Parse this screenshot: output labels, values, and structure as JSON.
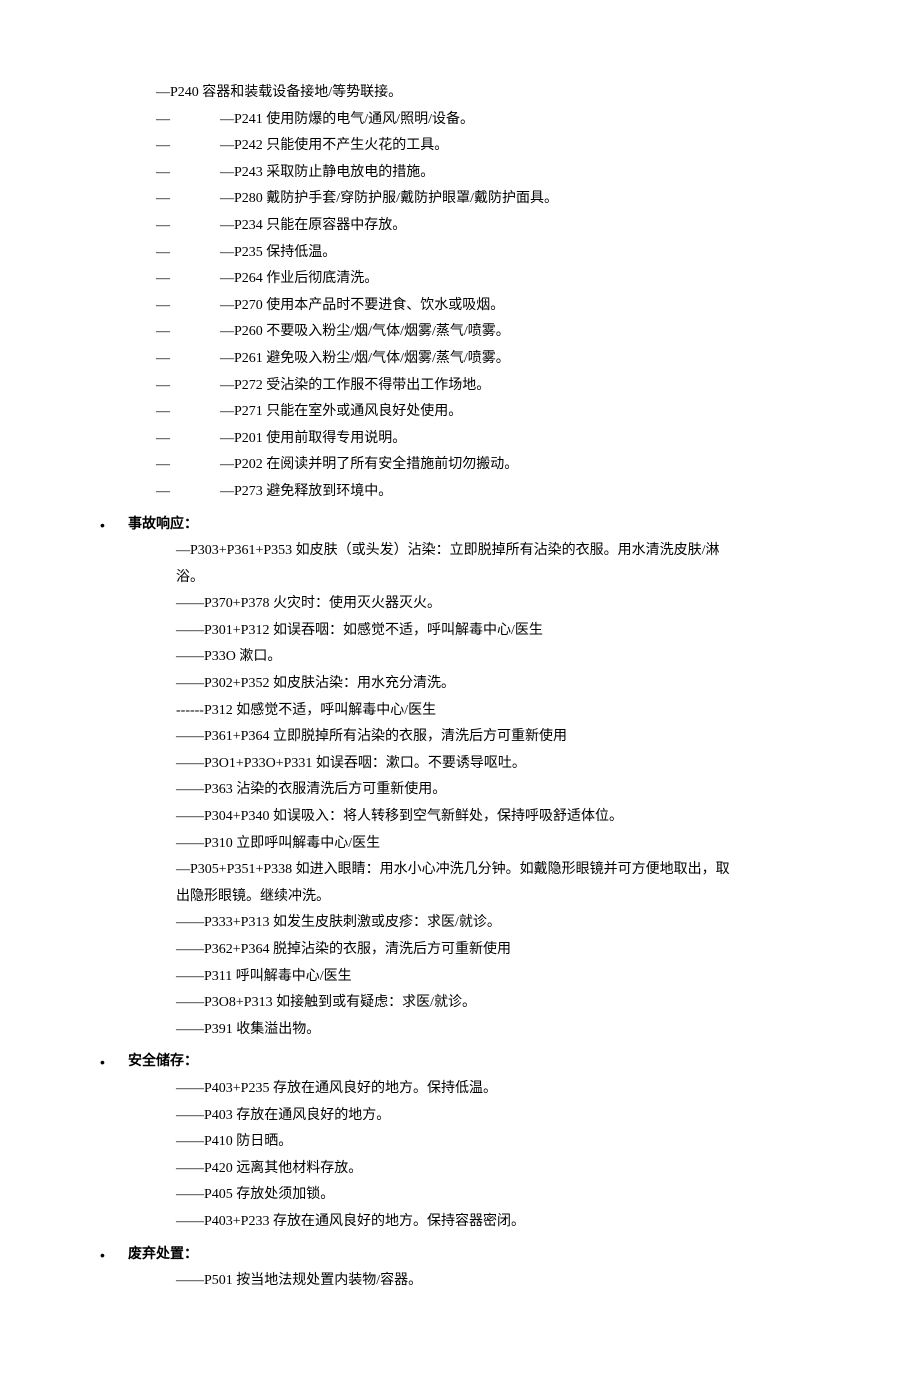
{
  "precaution_first": "—P240 容器和装载设备接地/等势联接。",
  "precaution_lines": [
    "—P241 使用防爆的电气/通风/照明/设备。",
    "—P242 只能使用不产生火花的工具。",
    "—P243 采取防止静电放电的措施。",
    "—P280 戴防护手套/穿防护服/戴防护眼罩/戴防护面具。",
    "—P234 只能在原容器中存放。",
    "—P235 保持低温。",
    "—P264 作业后彻底清洗。",
    "—P270 使用本产品时不要进食、饮水或吸烟。",
    "—P260 不要吸入粉尘/烟/气体/烟雾/蒸气/喷雾。",
    "—P261 避免吸入粉尘/烟/气体/烟雾/蒸气/喷雾。",
    "—P272 受沾染的工作服不得带出工作场地。",
    "—P271 只能在室外或通风良好处使用。",
    "—P201 使用前取得专用说明。",
    "—P202 在阅读并明了所有安全措施前切勿搬动。",
    "—P273 避免释放到环境中。"
  ],
  "section_response_title": "事故响应：",
  "response_block1_line1": "—P303+P361+P353 如皮肤（或头发）沾染：立即脱掉所有沾染的衣服。用水清洗皮肤/淋",
  "response_block1_line2": "浴。",
  "response_lines": [
    "——P370+P378 火灾时：使用灭火器灭火。",
    "——P301+P312 如误吞咽：如感觉不适，呼叫解毒中心/医生",
    "——P33O 漱口。",
    "——P302+P352 如皮肤沾染：用水充分清洗。",
    "------P312 如感觉不适，呼叫解毒中心/医生",
    "——P361+P364 立即脱掉所有沾染的衣服，清洗后方可重新使用",
    "——P3O1+P33O+P331 如误吞咽：漱口。不要诱导呕吐。",
    "——P363 沾染的衣服清洗后方可重新使用。",
    "——P304+P340 如误吸入：将人转移到空气新鲜处，保持呼吸舒适体位。",
    "——P310 立即呼叫解毒中心/医生"
  ],
  "response_block2_line1": "—P305+P351+P338 如进入眼睛：用水小心冲洗几分钟。如戴隐形眼镜并可方便地取出，取",
  "response_block2_line2": "出隐形眼镜。继续冲洗。",
  "response_lines2": [
    "——P333+P313 如发生皮肤刺激或皮疹：求医/就诊。",
    "——P362+P364 脱掉沾染的衣服，清洗后方可重新使用",
    "——P311 呼叫解毒中心/医生",
    "——P3O8+P313 如接触到或有疑虑：求医/就诊。",
    "——P391 收集溢出物。"
  ],
  "section_storage_title": "安全储存：",
  "storage_lines": [
    "——P403+P235 存放在通风良好的地方。保持低温。",
    "——P403 存放在通风良好的地方。",
    "——P410 防日晒。",
    "——P420 远离其他材料存放。",
    "——P405 存放处须加锁。",
    "——P403+P233 存放在通风良好的地方。保持容器密闭。"
  ],
  "section_disposal_title": "废弃处置：",
  "disposal_lines": [
    "——P501 按当地法规处置内装物/容器。"
  ],
  "dash_prefix": "—",
  "bullet": "•"
}
